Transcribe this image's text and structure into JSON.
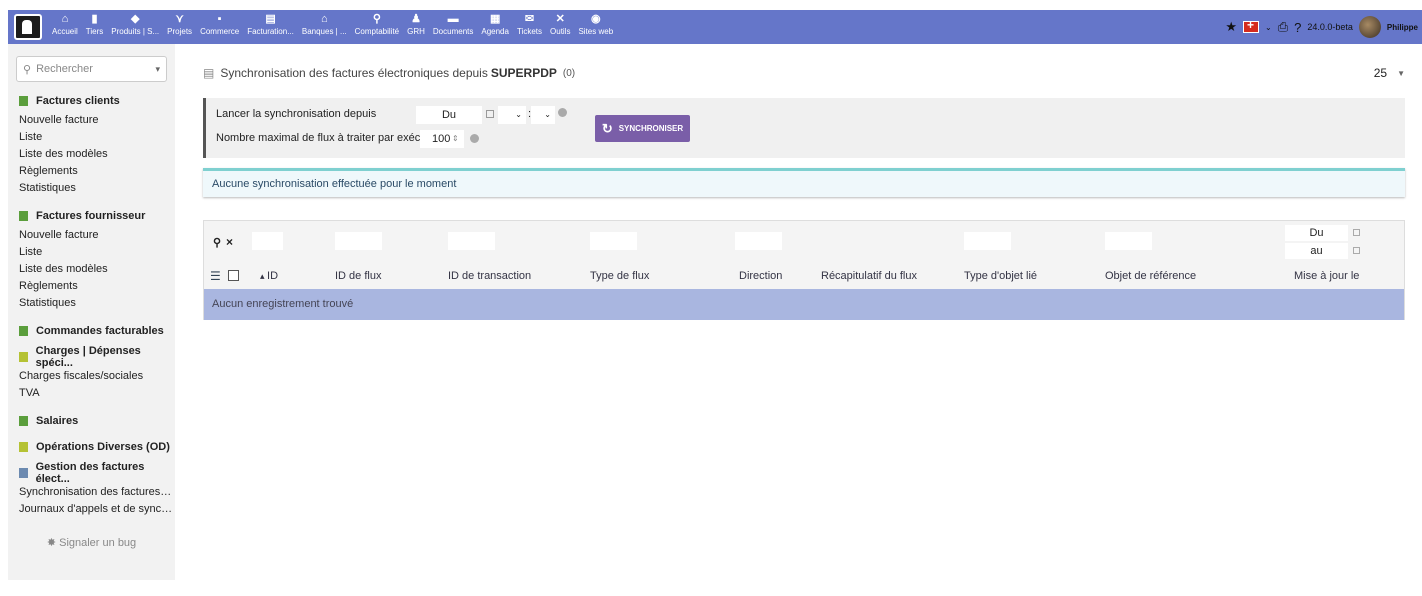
{
  "topbar": {
    "menu": [
      {
        "label": "Accueil",
        "icon": "home-icon",
        "glyph": "⌂"
      },
      {
        "label": "Tiers",
        "icon": "building-icon",
        "glyph": "▮"
      },
      {
        "label": "Produits | S...",
        "icon": "cube-icon",
        "glyph": "◆"
      },
      {
        "label": "Projets",
        "icon": "sitemap-icon",
        "glyph": "⋎"
      },
      {
        "label": "Commerce",
        "icon": "briefcase-icon",
        "glyph": "▪"
      },
      {
        "label": "Facturation...",
        "icon": "invoice-icon",
        "glyph": "▤"
      },
      {
        "label": "Banques | ...",
        "icon": "bank-icon",
        "glyph": "⌂"
      },
      {
        "label": "Comptabilité",
        "icon": "search-dollar-icon",
        "glyph": "⚲"
      },
      {
        "label": "GRH",
        "icon": "users-icon",
        "glyph": "♟"
      },
      {
        "label": "Documents",
        "icon": "folder-icon",
        "glyph": "▬"
      },
      {
        "label": "Agenda",
        "icon": "calendar-icon",
        "glyph": "▦"
      },
      {
        "label": "Tickets",
        "icon": "ticket-icon",
        "glyph": "✉"
      },
      {
        "label": "Outils",
        "icon": "tools-icon",
        "glyph": "✕"
      },
      {
        "label": "Sites web",
        "icon": "globe-icon",
        "glyph": "◉"
      }
    ],
    "version": "24.0.0-beta",
    "username": "Philippe"
  },
  "sidebar": {
    "search_placeholder": "Rechercher",
    "sections": [
      {
        "title": "Factures clients",
        "color": "#5b9e3c",
        "links": [
          "Nouvelle facture",
          "Liste",
          "Liste des modèles",
          "Règlements",
          "Statistiques"
        ]
      },
      {
        "title": "Factures fournisseur",
        "color": "#5b9e3c",
        "links": [
          "Nouvelle facture",
          "Liste",
          "Liste des modèles",
          "Règlements",
          "Statistiques"
        ]
      },
      {
        "title": "Commandes facturables",
        "color": "#5b9e3c",
        "links": []
      },
      {
        "title": "Charges | Dépenses spéci...",
        "color": "#b5c234",
        "links": [
          "Charges fiscales/sociales",
          "TVA"
        ]
      },
      {
        "title": "Salaires",
        "color": "#5b9e3c",
        "links": []
      },
      {
        "title": "Opérations Diverses (OD)",
        "color": "#b5c234",
        "links": []
      },
      {
        "title": "Gestion des factures élect...",
        "color": "#6c8ab0",
        "links": [
          "Synchronisation des factures él...",
          "Journaux d'appels et de synchro..."
        ]
      }
    ],
    "bug_label": "Signaler un bug"
  },
  "main": {
    "title": "Synchronisation des factures électroniques depuis",
    "title_strong": "SUPERPDP",
    "count": "(0)",
    "page_size": "25",
    "sync": {
      "label_from": "Lancer la synchronisation depuis",
      "date_value": "Du",
      "label_max": "Nombre maximal de flux à traiter par exécution",
      "max_value": "100",
      "button_label": "SYNCHRONISER"
    },
    "notice": "Aucune synchronisation effectuée pour le moment",
    "table": {
      "date_from": "Du",
      "date_to": "au",
      "columns": [
        "ID",
        "ID de flux",
        "ID de transaction",
        "Type de flux",
        "Direction",
        "Récapitulatif du flux",
        "Type d'objet lié",
        "Objet de référence",
        "Mise à jour le"
      ],
      "empty": "Aucun enregistrement trouvé"
    }
  }
}
